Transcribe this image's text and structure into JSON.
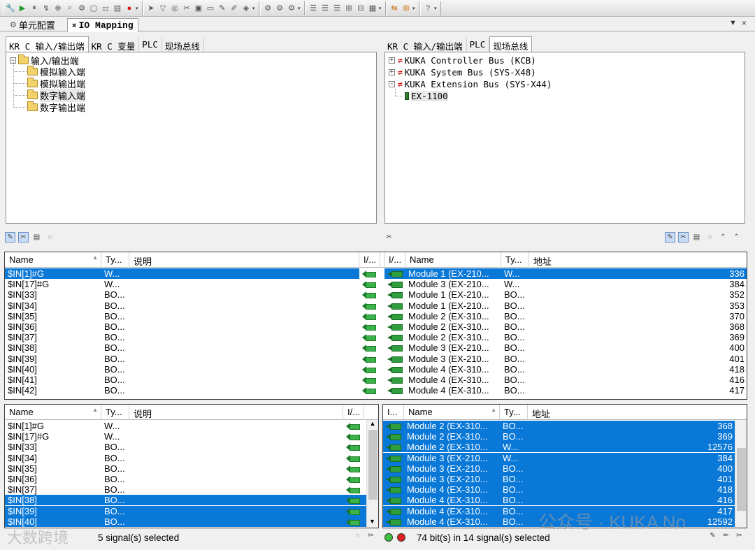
{
  "toolbar": {
    "groups": [
      [
        "wrench-icon",
        "play-icon",
        "pause-icon",
        "step-icon",
        "stop-icon",
        "search-icon",
        "settings-icon",
        "page-icon",
        "network-icon",
        "doc-icon",
        "record-icon"
      ],
      [
        "nav-icon",
        "filter-icon",
        "target-icon",
        "tools-icon",
        "save-icon",
        "monitor-icon",
        "edit-icon",
        "note-icon",
        "cube-icon"
      ],
      [
        "gear-a-icon",
        "gear-b-icon",
        "gear-c-icon"
      ],
      [
        "align-left-icon",
        "align-center-icon",
        "align-right-icon",
        "expand-icon",
        "collapse-icon",
        "grid-icon"
      ],
      [
        "mapping-icon",
        "bus-icon"
      ],
      [
        "help-icon"
      ]
    ]
  },
  "tabs": {
    "cell_config": "单元配置",
    "io_mapping": "IO Mapping"
  },
  "left_panel": {
    "tabs": [
      "KR C 输入/输出端",
      "KR C 变量",
      "PLC",
      "现场总线"
    ],
    "active_tab": 0,
    "tree": {
      "root": "输入/输出端",
      "children": [
        "模拟输入端",
        "模拟输出端",
        "数字输入端",
        "数字输出端"
      ],
      "selected": 2
    }
  },
  "right_panel": {
    "tabs": [
      "KR C 输入/输出端",
      "PLC",
      "现场总线"
    ],
    "active_tab": 2,
    "tree": {
      "items": [
        {
          "label": "KUKA Controller Bus (KCB)",
          "expander": "+"
        },
        {
          "label": "KUKA System Bus (SYS-X48)",
          "expander": "+"
        },
        {
          "label": "KUKA Extension Bus (SYS-X44)",
          "expander": "-"
        }
      ],
      "child": "EX-1100"
    }
  },
  "upper_grid_left": {
    "headers": [
      "Name",
      "Ty...",
      "说明",
      "I/..."
    ],
    "rows": [
      {
        "name": "$IN[1]#G",
        "type": "W...",
        "desc": "",
        "sel": true
      },
      {
        "name": "$IN[17]#G",
        "type": "W...",
        "desc": "",
        "sel": false
      },
      {
        "name": "$IN[33]",
        "type": "BO...",
        "desc": "",
        "sel": false
      },
      {
        "name": "$IN[34]",
        "type": "BO...",
        "desc": "",
        "sel": false
      },
      {
        "name": "$IN[35]",
        "type": "BO...",
        "desc": "",
        "sel": false
      },
      {
        "name": "$IN[36]",
        "type": "BO...",
        "desc": "",
        "sel": false
      },
      {
        "name": "$IN[37]",
        "type": "BO...",
        "desc": "",
        "sel": false
      },
      {
        "name": "$IN[38]",
        "type": "BO...",
        "desc": "",
        "sel": false
      },
      {
        "name": "$IN[39]",
        "type": "BO...",
        "desc": "",
        "sel": false
      },
      {
        "name": "$IN[40]",
        "type": "BO...",
        "desc": "",
        "sel": false
      },
      {
        "name": "$IN[41]",
        "type": "BO...",
        "desc": "",
        "sel": false
      },
      {
        "name": "$IN[42]",
        "type": "BO...",
        "desc": "",
        "sel": false
      }
    ]
  },
  "upper_grid_right": {
    "headers": [
      "I/...",
      "Name",
      "Ty...",
      "地址"
    ],
    "rows": [
      {
        "name": "Module 1 (EX-210...",
        "type": "W...",
        "addr": "336",
        "sel": true
      },
      {
        "name": "Module 3 (EX-210...",
        "type": "W...",
        "addr": "384",
        "sel": false
      },
      {
        "name": "Module 1 (EX-210...",
        "type": "BO...",
        "addr": "352",
        "sel": false
      },
      {
        "name": "Module 1 (EX-210...",
        "type": "BO...",
        "addr": "353",
        "sel": false
      },
      {
        "name": "Module 2 (EX-310...",
        "type": "BO...",
        "addr": "370",
        "sel": false
      },
      {
        "name": "Module 2 (EX-310...",
        "type": "BO...",
        "addr": "368",
        "sel": false
      },
      {
        "name": "Module 2 (EX-310...",
        "type": "BO...",
        "addr": "369",
        "sel": false
      },
      {
        "name": "Module 3 (EX-210...",
        "type": "BO...",
        "addr": "400",
        "sel": false
      },
      {
        "name": "Module 3 (EX-210...",
        "type": "BO...",
        "addr": "401",
        "sel": false
      },
      {
        "name": "Module 4 (EX-310...",
        "type": "BO...",
        "addr": "418",
        "sel": false
      },
      {
        "name": "Module 4 (EX-310...",
        "type": "BO...",
        "addr": "416",
        "sel": false
      },
      {
        "name": "Module 4 (EX-310...",
        "type": "BO...",
        "addr": "417",
        "sel": false
      }
    ]
  },
  "lower_grid_left": {
    "headers": [
      "Name",
      "Ty...",
      "说明",
      "I/..."
    ],
    "rows": [
      {
        "name": "$IN[1]#G",
        "type": "W...",
        "desc": "",
        "sel": false
      },
      {
        "name": "$IN[17]#G",
        "type": "W...",
        "desc": "",
        "sel": false
      },
      {
        "name": "$IN[33]",
        "type": "BO...",
        "desc": "",
        "sel": false
      },
      {
        "name": "$IN[34]",
        "type": "BO...",
        "desc": "",
        "sel": false
      },
      {
        "name": "$IN[35]",
        "type": "BO...",
        "desc": "",
        "sel": false
      },
      {
        "name": "$IN[36]",
        "type": "BO...",
        "desc": "",
        "sel": false
      },
      {
        "name": "$IN[37]",
        "type": "BO...",
        "desc": "",
        "sel": false
      },
      {
        "name": "$IN[38]",
        "type": "BO...",
        "desc": "",
        "sel": true
      },
      {
        "name": "$IN[39]",
        "type": "BO...",
        "desc": "",
        "sel": true
      },
      {
        "name": "$IN[40]",
        "type": "BO...",
        "desc": "",
        "sel": true
      }
    ]
  },
  "lower_grid_right": {
    "headers": [
      "I...",
      "Name",
      "Ty...",
      "地址"
    ],
    "rows": [
      {
        "name": "Module 2 (EX-310...",
        "type": "BO...",
        "addr": "368",
        "sel": true
      },
      {
        "name": "Module 2 (EX-310...",
        "type": "BO...",
        "addr": "369",
        "sel": true
      },
      {
        "name": "Module 2 (EX-310...",
        "type": "W...",
        "addr": "12576",
        "sel": true
      },
      {
        "name": "Module 3 (EX-210...",
        "type": "W...",
        "addr": "384",
        "sel": true
      },
      {
        "name": "Module 3 (EX-210...",
        "type": "BO...",
        "addr": "400",
        "sel": true
      },
      {
        "name": "Module 3 (EX-210...",
        "type": "BO...",
        "addr": "401",
        "sel": true
      },
      {
        "name": "Module 4 (EX-310...",
        "type": "BO...",
        "addr": "418",
        "sel": true
      },
      {
        "name": "Module 4 (EX-310...",
        "type": "BO...",
        "addr": "416",
        "sel": true
      },
      {
        "name": "Module 4 (EX-310...",
        "type": "BO...",
        "addr": "417",
        "sel": true
      },
      {
        "name": "Module 4 (EX-310...",
        "type": "BO...",
        "addr": "12592",
        "sel": true
      }
    ]
  },
  "status": {
    "left": "5 signal(s) selected",
    "right": "74 bit(s) in 14 signal(s) selected"
  },
  "watermark": {
    "left": "大数跨境",
    "right": "公众号 · KUKA No"
  },
  "colors": {
    "selection": "#0a78d7",
    "arrow_green": "#3bb34a"
  }
}
